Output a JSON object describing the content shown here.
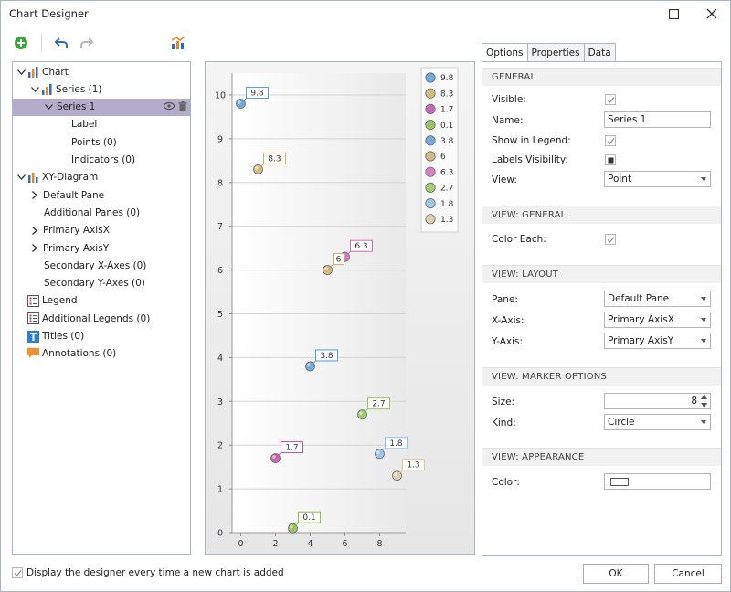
{
  "window": {
    "title": "Chart Designer"
  },
  "tree": [
    {
      "label": "Chart",
      "indent": 0,
      "chev": "down",
      "icon": "bar"
    },
    {
      "label": "Series (1)",
      "indent": 1,
      "chev": "down",
      "icon": "bar"
    },
    {
      "label": "Series 1",
      "indent": 2,
      "chev": "down",
      "icon": "",
      "selected": true
    },
    {
      "label": "Label",
      "indent": 3,
      "chev": "",
      "icon": ""
    },
    {
      "label": "Points (0)",
      "indent": 3,
      "chev": "",
      "icon": ""
    },
    {
      "label": "Indicators (0)",
      "indent": 3,
      "chev": "",
      "icon": ""
    },
    {
      "label": "XY-Diagram",
      "indent": 0,
      "chev": "down",
      "icon": "diagram"
    },
    {
      "label": "Default Pane",
      "indent": 1,
      "chev": "right",
      "icon": ""
    },
    {
      "label": "Additional Panes (0)",
      "indent": 1,
      "chev": "",
      "icon": ""
    },
    {
      "label": "Primary AxisX",
      "indent": 1,
      "chev": "right",
      "icon": ""
    },
    {
      "label": "Primary AxisY",
      "indent": 1,
      "chev": "right",
      "icon": ""
    },
    {
      "label": "Secondary X-Axes (0)",
      "indent": 1,
      "chev": "",
      "icon": ""
    },
    {
      "label": "Secondary Y-Axes (0)",
      "indent": 1,
      "chev": "",
      "icon": ""
    },
    {
      "label": "Legend",
      "indent": 0,
      "chev": "",
      "icon": "legend"
    },
    {
      "label": "Additional Legends (0)",
      "indent": 0,
      "chev": "",
      "icon": "legend"
    },
    {
      "label": "Titles (0)",
      "indent": 0,
      "chev": "",
      "icon": "title"
    },
    {
      "label": "Annotations (0)",
      "indent": 0,
      "chev": "",
      "icon": "annotation"
    }
  ],
  "tabs": [
    "Options",
    "Properties",
    "Data"
  ],
  "props": {
    "general_title": "GENERAL",
    "visible_label": "Visible:",
    "name_label": "Name:",
    "name_value": "Series 1",
    "show_legend_label": "Show in Legend:",
    "labels_visibility_label": "Labels Visibility:",
    "view_label": "View:",
    "view_value": "Point",
    "view_general_title": "VIEW: GENERAL",
    "color_each_label": "Color Each:",
    "view_layout_title": "VIEW: LAYOUT",
    "pane_label": "Pane:",
    "pane_value": "Default Pane",
    "xaxis_label": "X-Axis:",
    "xaxis_value": "Primary AxisX",
    "yaxis_label": "Y-Axis:",
    "yaxis_value": "Primary AxisY",
    "marker_title": "VIEW: MARKER OPTIONS",
    "size_label": "Size:",
    "size_value": "8",
    "kind_label": "Kind:",
    "kind_value": "Circle",
    "appearance_title": "VIEW: APPEARANCE",
    "color_label": "Color:"
  },
  "footer": {
    "display_designer": "Display the designer every time a new chart is added",
    "ok": "OK",
    "cancel": "Cancel"
  },
  "chart_data": {
    "type": "scatter",
    "points": [
      {
        "x": 0,
        "y": 9.8,
        "label": "9.8",
        "color": "#5b9bd5"
      },
      {
        "x": 1,
        "y": 8.3,
        "label": "8.3",
        "color": "#c8b26a"
      },
      {
        "x": 2,
        "y": 1.7,
        "label": "1.7",
        "color": "#c04fa6"
      },
      {
        "x": 3,
        "y": 0.1,
        "label": "0.1",
        "color": "#8dbb4a"
      },
      {
        "x": 4,
        "y": 3.8,
        "label": "3.8",
        "color": "#5b9bd5"
      },
      {
        "x": 5,
        "y": 6,
        "label": "6",
        "color": "#c8b26a"
      },
      {
        "x": 6,
        "y": 6.3,
        "label": "6.3",
        "color": "#d36bbb"
      },
      {
        "x": 7,
        "y": 2.7,
        "label": "2.7",
        "color": "#98c45a"
      },
      {
        "x": 8,
        "y": 1.8,
        "label": "1.8",
        "color": "#8fc0e8"
      },
      {
        "x": 9,
        "y": 1.3,
        "label": "1.3",
        "color": "#d8c9a2"
      }
    ],
    "legend": [
      "9.8",
      "8.3",
      "1.7",
      "0.1",
      "3.8",
      "6",
      "6.3",
      "2.7",
      "1.8",
      "1.3"
    ],
    "x_ticks": [
      "0",
      "2",
      "4",
      "6",
      "8"
    ],
    "y_ticks": [
      "0",
      "1",
      "2",
      "3",
      "4",
      "5",
      "6",
      "7",
      "8",
      "9",
      "10"
    ],
    "xlim": [
      -0.5,
      9.5
    ],
    "ylim": [
      0,
      10.5
    ],
    "grid": true,
    "legend_position": "top-right"
  }
}
